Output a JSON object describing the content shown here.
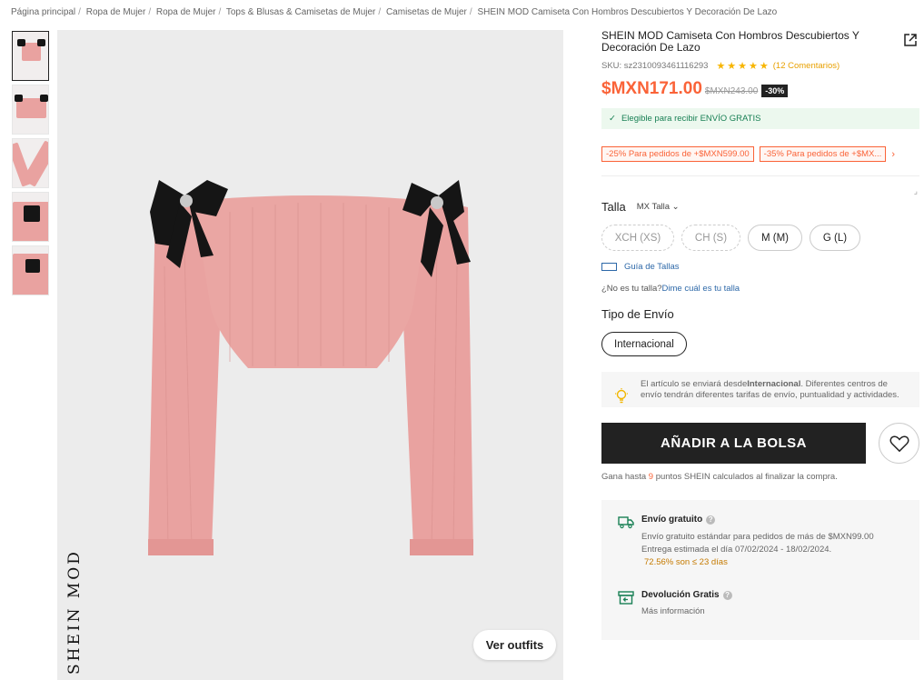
{
  "breadcrumb": [
    "Página principal",
    "Ropa de Mujer",
    "Ropa de Mujer",
    "Tops & Blusas & Camisetas de Mujer",
    "Camisetas de Mujer",
    "SHEIN MOD Camiseta Con Hombros Descubiertos Y Decoración De Lazo"
  ],
  "gallery": {
    "brand_watermark": "SHEIN MOD",
    "outfits_label": "Ver outfits",
    "thumb_count": 5
  },
  "product": {
    "title": "SHEIN MOD Camiseta Con Hombros Descubiertos Y Decoración De Lazo",
    "sku": "SKU: sz2310093461116293",
    "rating": 5,
    "reviews": "(12 Comentarios)",
    "price": "$MXN171.00",
    "old_price": "$MXN243.00",
    "discount": "-30%",
    "shipping_eligible": "Elegible para recibir ENVÍO GRATIS",
    "coupons": [
      "-25% Para pedidos de +$MXN599.00",
      "-35% Para pedidos de +$MX..."
    ]
  },
  "size": {
    "label": "Talla",
    "selector": "MX Talla",
    "options": [
      {
        "label": "XCH (XS)",
        "available": false
      },
      {
        "label": "CH (S)",
        "available": false
      },
      {
        "label": "M (M)",
        "available": true
      },
      {
        "label": "G (L)",
        "available": true
      }
    ],
    "guide": "Guía de Tallas",
    "fit_question": "¿No es tu talla?",
    "fit_link": "Dime cuál es tu talla"
  },
  "shipping_type": {
    "label": "Tipo de Envío",
    "option": "Internacional",
    "notice_pre": "El artículo se enviará desde",
    "notice_bold": "Internacional",
    "notice_post": ". Diferentes centros de envío tendrán diferentes tarifas de envío, puntualidad y actividades."
  },
  "actions": {
    "add_to_bag": "AÑADIR A LA BOLSA",
    "points_pre": "Gana hasta ",
    "points_value": "9",
    "points_post": " puntos SHEIN calculados al finalizar la compra."
  },
  "perks": {
    "free_shipping": {
      "title": "Envío gratuito",
      "line1": "Envío gratuito estándar para pedidos de más de $MXN99.00",
      "line2": "Entrega estimada el día 07/02/2024 - 18/02/2024.",
      "stat": "72.56% son ≤ 23 días"
    },
    "returns": {
      "title": "Devolución Gratis",
      "line1": "Más información"
    }
  },
  "colors": {
    "accent": "#fa6338",
    "link": "#2d68a8",
    "garment": "#e9a2a0",
    "bow": "#151515"
  }
}
